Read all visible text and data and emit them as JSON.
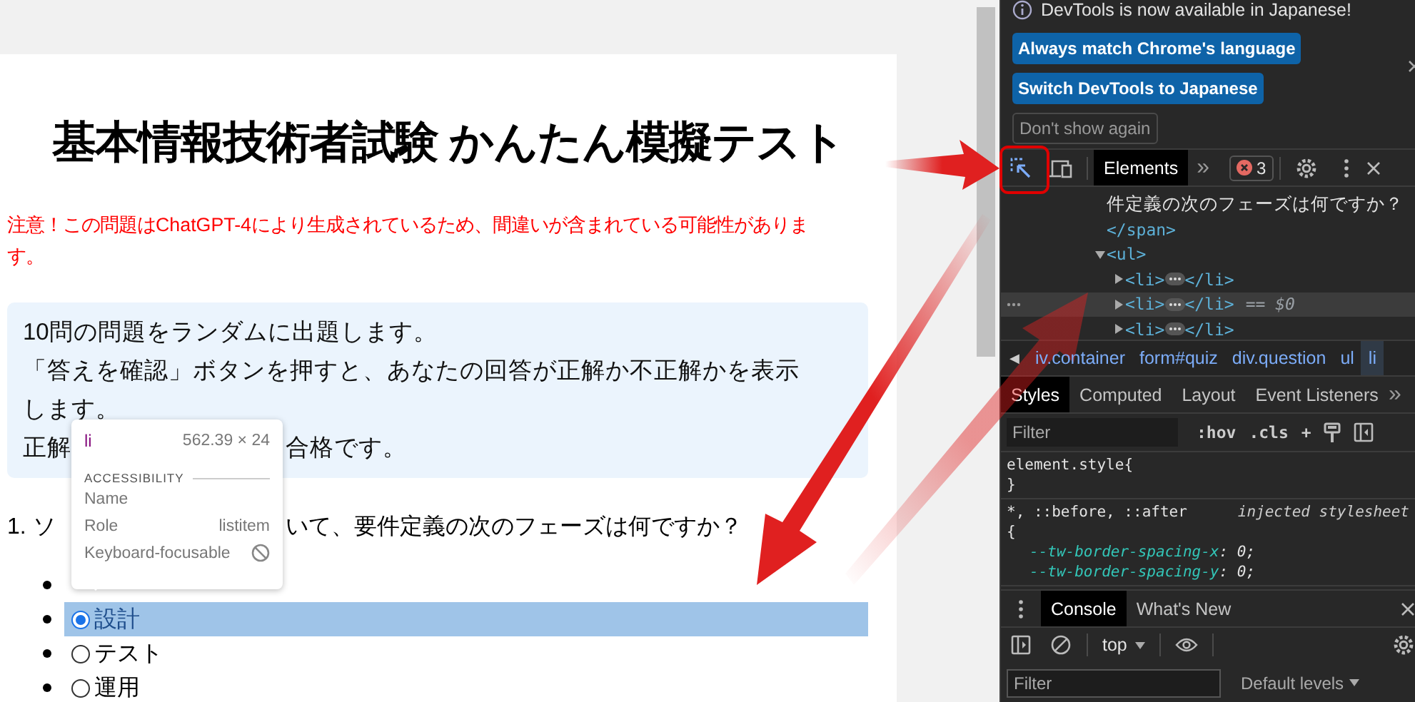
{
  "page": {
    "title": "基本情報技術者試験 かんたん模擬テスト",
    "notice": "注意！この問題はChatGPT-4により生成されているため、間違いが含まれている可能性があります。",
    "intro": [
      "10問の問題をランダムに出題します。",
      "「答えを確認」ボタンを押すと、あなたの回答が正解か不正解かを表示します。"
    ],
    "intro_partial": [
      "正解",
      "合格です。"
    ],
    "question_parts": [
      "1. ソ",
      "いて、要件定義の次のフェーズは何ですか？"
    ],
    "options": [
      {
        "kind": "covered"
      },
      {
        "kind": "choice",
        "label": "設計",
        "checked": true,
        "highlighted": true
      },
      {
        "kind": "choice",
        "label": "テスト",
        "checked": false,
        "highlighted": false
      },
      {
        "kind": "choice",
        "label": "運用",
        "checked": false,
        "highlighted": false
      }
    ]
  },
  "tooltip": {
    "tag": "li",
    "size": "562.39 × 24",
    "section": "ACCESSIBILITY",
    "rows": [
      {
        "label": "Name",
        "kind": "empty"
      },
      {
        "label": "Role",
        "kind": "text",
        "value": "listitem"
      },
      {
        "label": "Keyboard-focusable",
        "kind": "blocked"
      }
    ]
  },
  "devtools": {
    "infobar": {
      "message": "DevTools is now available in Japanese!",
      "buttons": [
        {
          "label": "Always match Chrome's language",
          "kind": "primary"
        },
        {
          "label": "Switch DevTools to Japanese",
          "kind": "primary"
        },
        {
          "label": "Don't show again",
          "kind": "secondary"
        }
      ]
    },
    "toolbar": {
      "inspect_active": true,
      "tabs": [
        {
          "label": "Elements",
          "selected": true
        }
      ],
      "more": "»",
      "error_count": "3"
    },
    "dom": [
      {
        "kind": "text",
        "text": "件定義の次のフェーズは何ですか？"
      },
      {
        "kind": "close",
        "text": "</span>"
      },
      {
        "kind": "element",
        "open": "<ul>",
        "expanded": true,
        "children": [
          {
            "kind": "element",
            "open": "<li>",
            "close": "</li>",
            "expanded": false,
            "selected": false
          },
          {
            "kind": "element",
            "open": "<li>",
            "close": "</li>",
            "expanded": false,
            "selected": true,
            "marker": "== $0"
          },
          {
            "kind": "element",
            "open": "<li>",
            "close": "</li>",
            "expanded": false,
            "selected": false
          }
        ]
      }
    ],
    "breadcrumb_scroll": "◀",
    "breadcrumbs": [
      {
        "label": "iv.container",
        "selected": false
      },
      {
        "label": "form#quiz",
        "selected": false
      },
      {
        "label": "div.question",
        "selected": false
      },
      {
        "label": "ul",
        "selected": false
      },
      {
        "label": "li",
        "selected": true
      }
    ],
    "styles_tabs": [
      {
        "label": "Styles",
        "selected": true
      },
      {
        "label": "Computed",
        "selected": false
      },
      {
        "label": "Layout",
        "selected": false
      },
      {
        "label": "Event Listeners",
        "selected": false
      }
    ],
    "styles_more": "»",
    "styles_filter": {
      "placeholder": "Filter",
      "buttons": [
        ":hov",
        ".cls",
        "+"
      ]
    },
    "rules": [
      {
        "selector": "element.style",
        "open": "{",
        "close": "}"
      },
      {
        "selector": "*, ::before, ::after",
        "source": "injected stylesheet",
        "open": "{",
        "declarations": [
          {
            "property": "--tw-border-spacing-x",
            "rest": ": 0;"
          },
          {
            "property": "--tw-border-spacing-y",
            "rest": ": 0;"
          }
        ]
      }
    ],
    "drawer_tabs": [
      {
        "label": "Console",
        "selected": true
      },
      {
        "label": "What's New",
        "selected": false
      }
    ],
    "console": {
      "context": "top",
      "filter_placeholder": "Filter",
      "levels": "Default levels"
    }
  }
}
